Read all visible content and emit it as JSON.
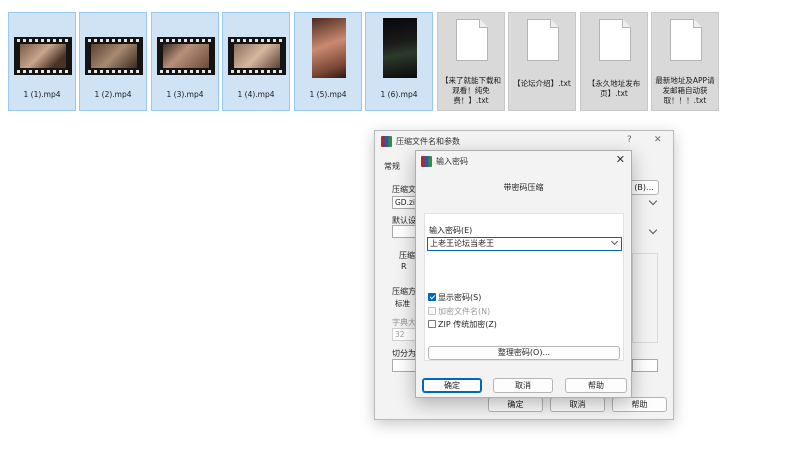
{
  "files": [
    {
      "name": "1 (1).mp4",
      "kind": "video"
    },
    {
      "name": "1 (2).mp4",
      "kind": "video"
    },
    {
      "name": "1 (3).mp4",
      "kind": "video"
    },
    {
      "name": "1 (4).mp4",
      "kind": "video"
    },
    {
      "name": "1 (5).mp4",
      "kind": "video-portrait"
    },
    {
      "name": "1 (6).mp4",
      "kind": "video-portrait-dark"
    },
    {
      "name": "【来了就能下载和观看！纯免费！】.txt",
      "kind": "text"
    },
    {
      "name": "【论坛介绍】.txt",
      "kind": "text"
    },
    {
      "name": "【永久地址发布页】.txt",
      "kind": "text"
    },
    {
      "name": "最新地址及APP请发邮箱自动获取！！！.txt",
      "kind": "text"
    }
  ],
  "archive_dialog": {
    "title": "压缩文件名和参数",
    "help_glyph": "?",
    "close_glyph": "✕",
    "tab_general": "常规",
    "archive_name_label": "压缩文",
    "archive_name_value": "GD.zip",
    "browse_button": "(B)...",
    "default_profile_label": "默认设",
    "format_label": "压缩",
    "format_option": "R",
    "method_label": "压缩方",
    "method_value": "标准",
    "dict_label": "字典大",
    "dict_value": "32",
    "split_label": "切分为",
    "ok": "确定",
    "cancel": "取消",
    "help": "帮助"
  },
  "password_dialog": {
    "title": "输入密码",
    "close_glyph": "✕",
    "header_label": "带密码压缩",
    "password_label": "输入密码(E)",
    "password_value": "上老王论坛当老王",
    "show_password_label": "显示密码(S)",
    "show_password_checked": true,
    "encrypt_names_label": "加密文件名(N)",
    "encrypt_names_enabled": false,
    "zip_legacy_label": "ZIP 传统加密(Z)",
    "zip_legacy_checked": false,
    "organize_button": "整理密码(O)...",
    "ok": "确定",
    "cancel": "取消",
    "help": "帮助"
  }
}
